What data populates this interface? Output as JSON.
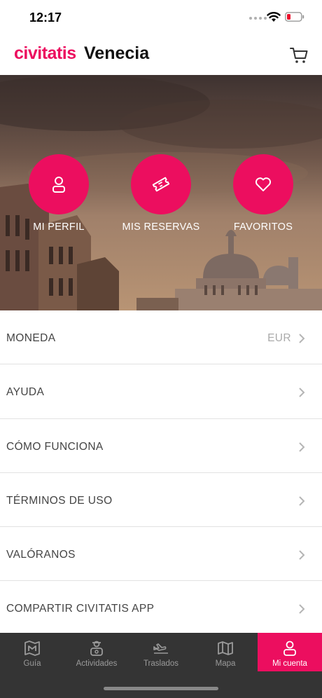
{
  "status_bar": {
    "time": "12:17",
    "wifi_icon": "wifi-icon",
    "battery_icon": "battery-low-icon",
    "battery_color": "#ec0e2c"
  },
  "header": {
    "brand": "civitatis",
    "title": "Venecia",
    "cart_icon": "cart-icon",
    "brand_color": "#ec0e5f"
  },
  "hero": {
    "actions": [
      {
        "label": "MI PERFIL",
        "icon": "user-icon"
      },
      {
        "label": "MIS RESERVAS",
        "icon": "ticket-icon"
      },
      {
        "label": "FAVORITOS",
        "icon": "heart-icon"
      }
    ]
  },
  "menu": [
    {
      "label": "MONEDA",
      "value": "EUR"
    },
    {
      "label": "AYUDA",
      "value": ""
    },
    {
      "label": "CÓMO FUNCIONA",
      "value": ""
    },
    {
      "label": "TÉRMINOS DE USO",
      "value": ""
    },
    {
      "label": "VALÓRANOS",
      "value": ""
    },
    {
      "label": "COMPARTIR CIVITATIS APP",
      "value": ""
    }
  ],
  "tabs": [
    {
      "label": "Guía",
      "icon": "map-guide-icon",
      "active": false
    },
    {
      "label": "Actividades",
      "icon": "guide-person-icon",
      "active": false
    },
    {
      "label": "Traslados",
      "icon": "plane-icon",
      "active": false
    },
    {
      "label": "Mapa",
      "icon": "map-icon",
      "active": false
    },
    {
      "label": "Mi cuenta",
      "icon": "user-icon",
      "active": true
    }
  ]
}
